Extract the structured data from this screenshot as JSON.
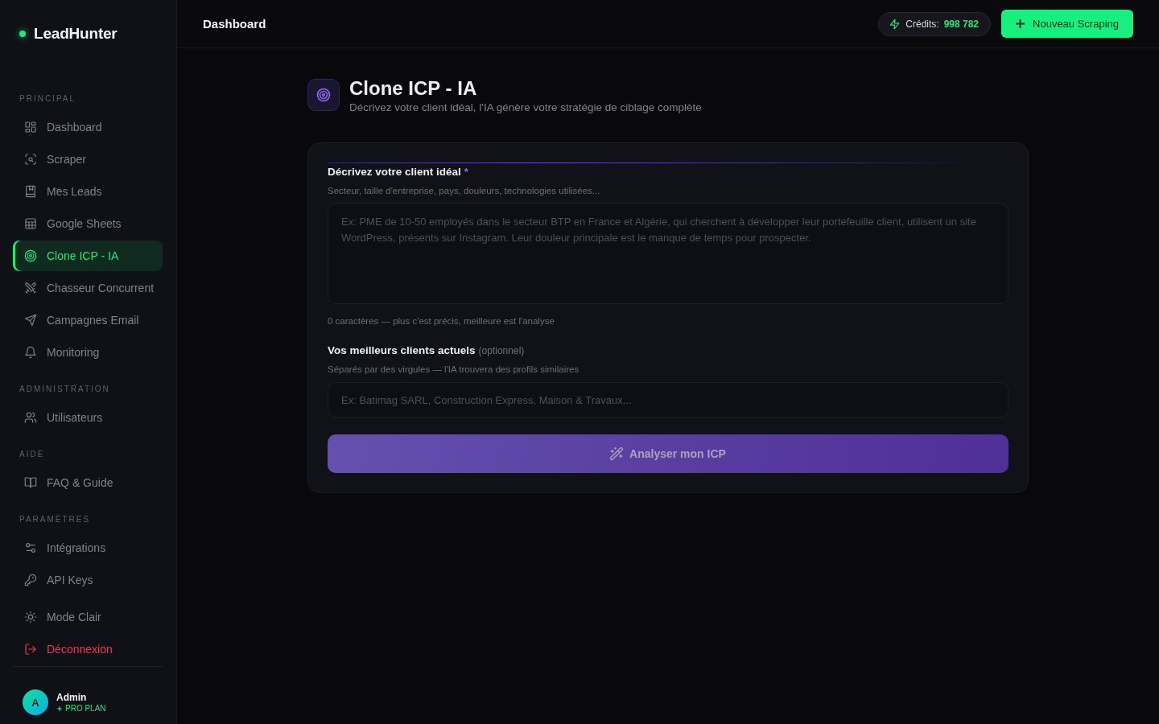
{
  "sidebar": {
    "brand": "LeadHunter",
    "sections": [
      {
        "title": "PRINCIPAL",
        "items": [
          {
            "label": "Dashboard",
            "selected": false
          },
          {
            "label": "Scraper",
            "selected": false
          },
          {
            "label": "Mes Leads",
            "selected": false
          },
          {
            "label": "Google Sheets",
            "selected": false
          },
          {
            "label": "Clone ICP - IA",
            "selected": true
          },
          {
            "label": "Chasseur Concurrent",
            "selected": false
          },
          {
            "label": "Campagnes Email",
            "selected": false
          },
          {
            "label": "Monitoring",
            "selected": false
          }
        ]
      },
      {
        "title": "ADMINISTRATION",
        "items": [
          {
            "label": "Utilisateurs",
            "selected": false
          }
        ]
      },
      {
        "title": "AIDE",
        "items": [
          {
            "label": "FAQ & Guide",
            "selected": false
          }
        ]
      },
      {
        "title": "PARAMÈTRES",
        "items": [
          {
            "label": "Intégrations",
            "selected": false
          },
          {
            "label": "API Keys",
            "selected": false
          }
        ]
      }
    ],
    "footer_items": [
      {
        "label": "Mode Clair",
        "kind": "theme"
      },
      {
        "label": "Déconnexion",
        "kind": "logout"
      }
    ],
    "user": {
      "initial": "A",
      "name": "Admin",
      "plan": "PRO PLAN"
    }
  },
  "topbar": {
    "title": "Dashboard",
    "credits": {
      "label": "Crédits:",
      "value": "998 782"
    },
    "new_button": "Nouveau Scraping"
  },
  "page": {
    "title": "Clone ICP - IA",
    "subtitle": "Décrivez votre client idéal, l'IA génère votre stratégie de ciblage complète"
  },
  "form": {
    "fields": [
      {
        "kind": "textarea",
        "label": "Décrivez votre client idéal",
        "required_mark": "*",
        "hint": "Secteur, taille d'entreprise, pays, douleurs, technologies utilisées...",
        "placeholder": "Ex: PME de 10-50 employés dans le secteur BTP en France et Algérie, qui cherchent à développer leur portefeuille client, utilisent un site WordPress, présents sur Instagram. Leur douleur principale est le manque de temps pour prospecter.",
        "counter": "0 caractères — plus c'est précis, meilleure est l'analyse"
      },
      {
        "kind": "input",
        "label": "Vos meilleurs clients actuels",
        "optional_note": "(optionnel)",
        "hint": "Séparés par des virgules — l'IA trouvera des profils similaires",
        "placeholder": "Ex: Batimag SARL, Construction Express, Maison & Travaux..."
      }
    ],
    "submit": {
      "label": "Analyser mon ICP",
      "disabled": true
    }
  }
}
